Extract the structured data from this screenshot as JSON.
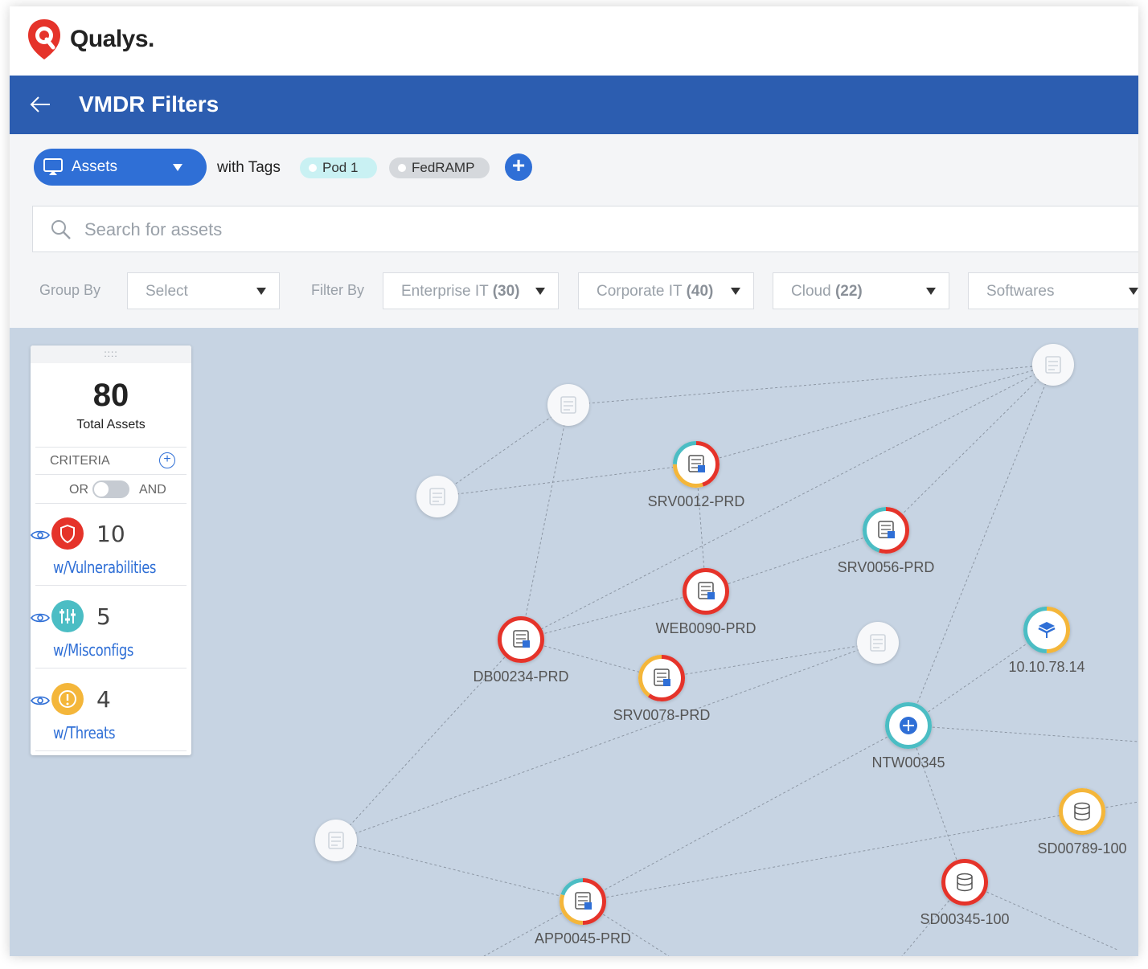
{
  "app": {
    "brand": "Qualys."
  },
  "header": {
    "title": "VMDR Filters"
  },
  "toolbar": {
    "asset_select": "Assets",
    "with_tags": "with Tags",
    "tags": [
      "Pod 1",
      "FedRAMP"
    ],
    "add_tag": "+",
    "search_placeholder": "Search for assets",
    "group_by_label": "Group By",
    "group_by_value": "Select",
    "filter_by_label": "Filter By",
    "filters": [
      {
        "name": "Enterprise IT",
        "count": "(30)"
      },
      {
        "name": "Corporate IT",
        "count": "(40)"
      },
      {
        "name": "Cloud",
        "count": "(22)"
      },
      {
        "name": "Softwares",
        "count": ""
      }
    ]
  },
  "panel": {
    "grip": "::::",
    "total_value": "80",
    "total_label": "Total Assets",
    "criteria_label": "CRITERIA",
    "criteria_add": "+",
    "or_label": "OR",
    "and_label": "AND",
    "criteria": [
      {
        "count": "10",
        "label": "w/Vulnerabilities",
        "color": "#e5332a"
      },
      {
        "count": "5",
        "label": "w/Misconfigs",
        "color": "#4bbdc4"
      },
      {
        "count": "4",
        "label": "w/Threats",
        "color": "#f4b63a"
      }
    ]
  },
  "graph": {
    "nodes": [
      {
        "id": "SRV0012-PRD",
        "label": "SRV0012-PRD",
        "ring": "mixed-red-yellow-teal",
        "icon": "server-windows-icon"
      },
      {
        "id": "SRV0056-PRD",
        "label": "SRV0056-PRD",
        "ring": "red-teal",
        "icon": "server-linux-icon"
      },
      {
        "id": "WEB0090-PRD",
        "label": "WEB0090-PRD",
        "ring": "red",
        "icon": "web-server-icon"
      },
      {
        "id": "DB00234-PRD",
        "label": "DB00234-PRD",
        "ring": "red",
        "icon": "database-server-icon"
      },
      {
        "id": "SRV0078-PRD",
        "label": "SRV0078-PRD",
        "ring": "red-yellow",
        "icon": "server-linux-icon"
      },
      {
        "id": "10.10.78.14",
        "label": "10.10.78.14",
        "ring": "yellow-teal",
        "icon": "cube-icon"
      },
      {
        "id": "NTW00345",
        "label": "NTW00345",
        "ring": "teal",
        "icon": "network-icon"
      },
      {
        "id": "SD00789-100",
        "label": "SD00789-100",
        "ring": "yellow",
        "icon": "storage-icon"
      },
      {
        "id": "SD00345-100",
        "label": "SD00345-100",
        "ring": "red",
        "icon": "storage-icon"
      },
      {
        "id": "APP0045-PRD",
        "label": "APP0045-PRD",
        "ring": "red-yellow-teal",
        "icon": "app-server-icon"
      }
    ]
  }
}
